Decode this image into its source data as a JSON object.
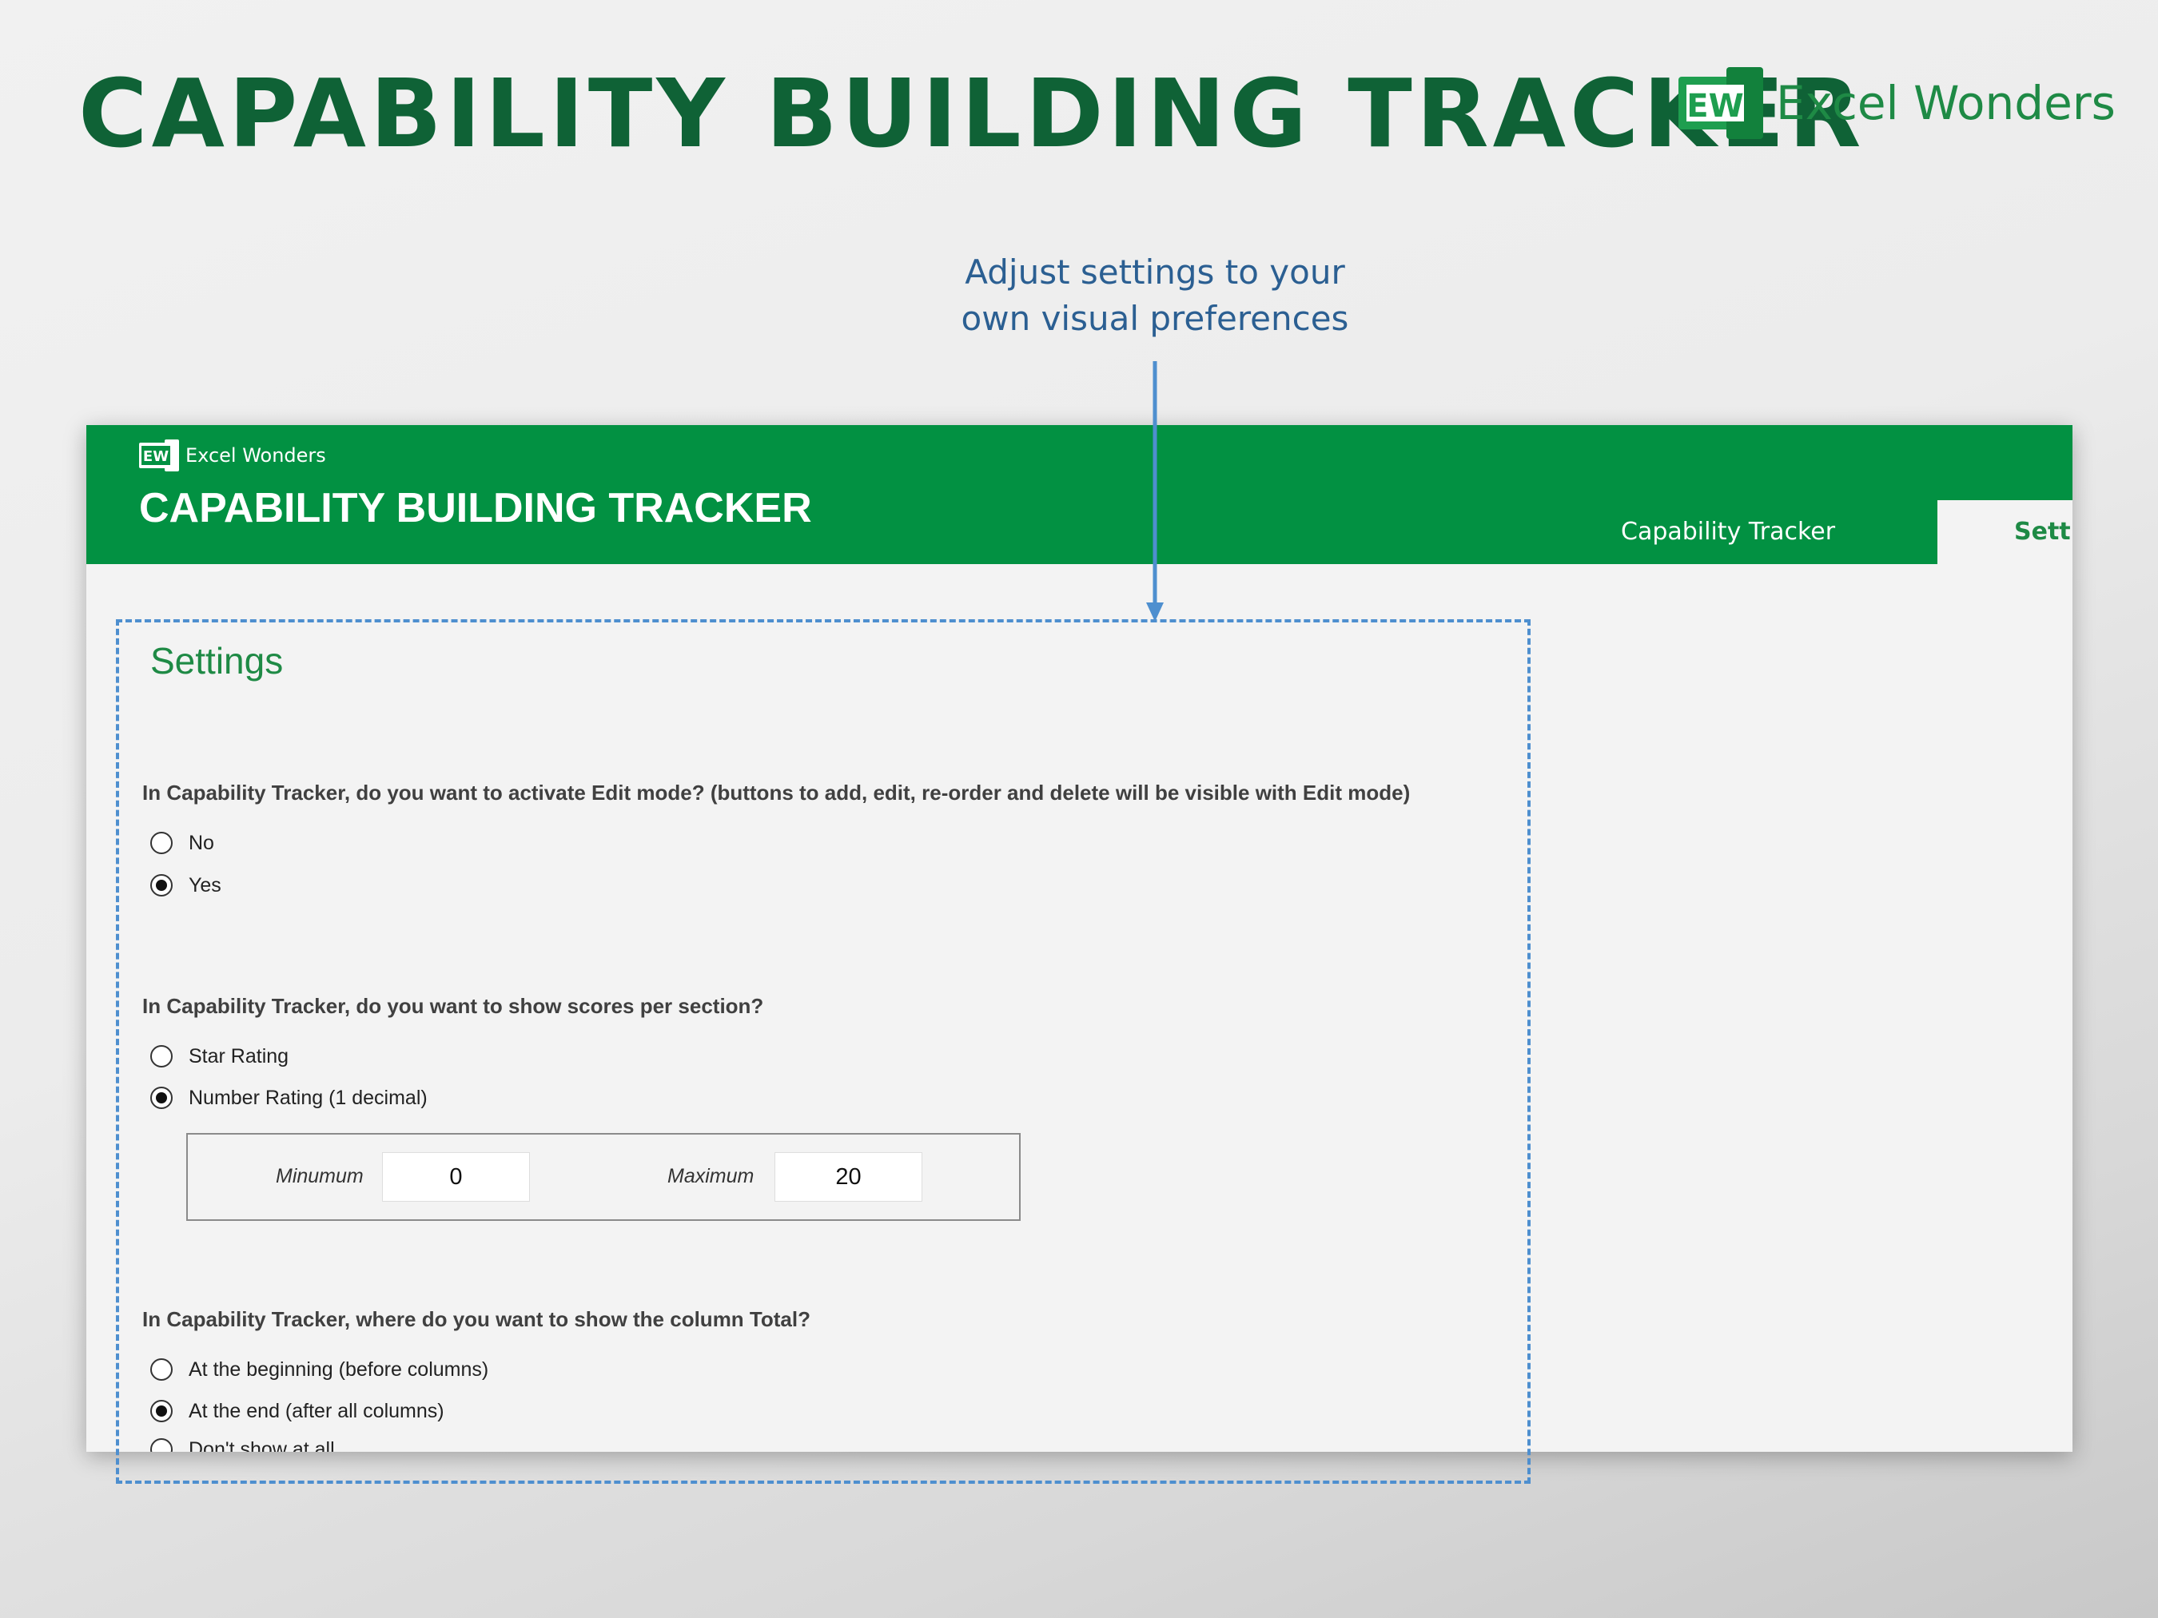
{
  "page_title": "CAPABILITY BUILDING TRACKER",
  "brand": {
    "logo_text": "EW",
    "name": "Excel Wonders"
  },
  "callout": {
    "line1": "Adjust settings to your",
    "line2": "own visual preferences"
  },
  "app": {
    "brand_name": "Excel Wonders",
    "title": "CAPABILITY BUILDING TRACKER",
    "tabs": [
      {
        "label": "Capability Tracker",
        "active": false
      },
      {
        "label": "Settings",
        "active": true
      }
    ],
    "header_color": "#029142"
  },
  "settings": {
    "title": "Settings",
    "questions": [
      {
        "text": "In Capability Tracker, do you want to activate Edit mode? (buttons to add, edit, re-order and delete will be visible with Edit mode)",
        "options": [
          {
            "label": "No",
            "selected": false
          },
          {
            "label": "Yes",
            "selected": true
          }
        ]
      },
      {
        "text": "In Capability Tracker, do you want to show scores per section?",
        "options": [
          {
            "label": "Star Rating",
            "selected": false
          },
          {
            "label": "Number Rating (1 decimal)",
            "selected": true
          }
        ],
        "range": {
          "min_label": "Minumum",
          "min_value": "0",
          "max_label": "Maximum",
          "max_value": "20"
        }
      },
      {
        "text": "In Capability Tracker, where do you want to show the column Total?",
        "options": [
          {
            "label": "At the beginning (before columns)",
            "selected": false
          },
          {
            "label": "At the end (after all columns)",
            "selected": true
          },
          {
            "label": "Don't show at all",
            "selected": false
          }
        ]
      }
    ]
  },
  "colors": {
    "title_green": "#0f6236",
    "accent_green": "#1e8a45",
    "callout_blue": "#2b5f92",
    "dashed_blue": "#4e8fcf"
  }
}
